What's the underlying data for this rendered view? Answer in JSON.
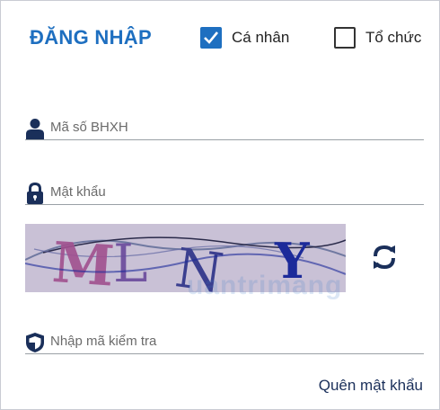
{
  "header": {
    "title": "ĐĂNG NHẬP"
  },
  "account_type": {
    "personal_label": "Cá nhân",
    "personal_checked": true,
    "organization_label": "Tổ chức",
    "organization_checked": false
  },
  "form": {
    "bhxh_placeholder": "Mã số BHXH",
    "password_placeholder": "Mật khẩu",
    "captcha_placeholder": "Nhập mã kiểm tra",
    "captcha_text": "MLNY",
    "forgot_password": "Quên mật khẩu"
  },
  "watermark": "uantrimang",
  "colors": {
    "accent": "#1e6fc0",
    "icon": "#1a2f5a",
    "captcha_bg": "#c9c1d6"
  }
}
